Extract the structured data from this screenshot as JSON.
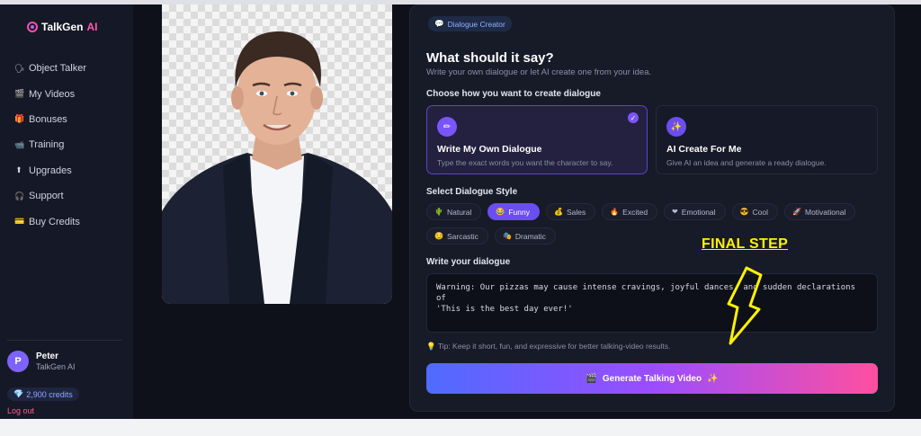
{
  "brand": {
    "name": "TalkGen",
    "suffix": "AI"
  },
  "sidebar": {
    "items": [
      {
        "label": "Object Talker",
        "icon": "🗣"
      },
      {
        "label": "My Videos",
        "icon": "🎬"
      },
      {
        "label": "Bonuses",
        "icon": "🎁"
      },
      {
        "label": "Training",
        "icon": "📹"
      },
      {
        "label": "Upgrades",
        "icon": "⬆"
      },
      {
        "label": "Support",
        "icon": "🎧"
      },
      {
        "label": "Buy Credits",
        "icon": "💳"
      }
    ]
  },
  "user": {
    "initial": "P",
    "name": "Peter",
    "org": "TalkGen AI",
    "credits": "2,900 credits",
    "logout": "Log out"
  },
  "panel": {
    "badge": "Dialogue Creator",
    "title": "What should it say?",
    "subtitle": "Write your own dialogue or let AI create one from your idea.",
    "method_label": "Choose how you want to create dialogue",
    "options": [
      {
        "title": "Write My Own Dialogue",
        "desc": "Type the exact words you want the character to say.",
        "icon": "✏",
        "selected": true
      },
      {
        "title": "AI Create For Me",
        "desc": "Give AI an idea and generate a ready dialogue.",
        "icon": "✨",
        "selected": false
      }
    ],
    "style_label": "Select Dialogue Style",
    "styles_row1": [
      {
        "label": "Natural",
        "icon": "🌵",
        "active": false
      },
      {
        "label": "Funny",
        "icon": "😂",
        "active": true
      },
      {
        "label": "Sales",
        "icon": "💰",
        "active": false
      },
      {
        "label": "Excited",
        "icon": "🔥",
        "active": false
      },
      {
        "label": "Emotional",
        "icon": "❤",
        "active": false
      },
      {
        "label": "Cool",
        "icon": "😎",
        "active": false
      },
      {
        "label": "Motivational",
        "icon": "🚀",
        "active": false
      }
    ],
    "styles_row2": [
      {
        "label": "Sarcastic",
        "icon": "😏",
        "active": false
      },
      {
        "label": "Dramatic",
        "icon": "🎭",
        "active": false
      }
    ],
    "dialogue_label": "Write your dialogue",
    "dialogue_text": "Warning: Our pizzas may cause intense cravings, joyful dances, and sudden declarations of\n'This is the best day ever!'",
    "tip": "Tip: Keep it short, fun, and expressive for better talking-video results.",
    "generate_label": "Generate Talking Video",
    "generate_icon": "🎬",
    "generate_sparkle": "✨"
  },
  "annotation": {
    "text": "FINAL STEP",
    "color": "#fff200"
  },
  "colors": {
    "accent": "#6a4ef0",
    "logout": "#ff5e8f",
    "brand_ai": "#ff5ab0"
  }
}
